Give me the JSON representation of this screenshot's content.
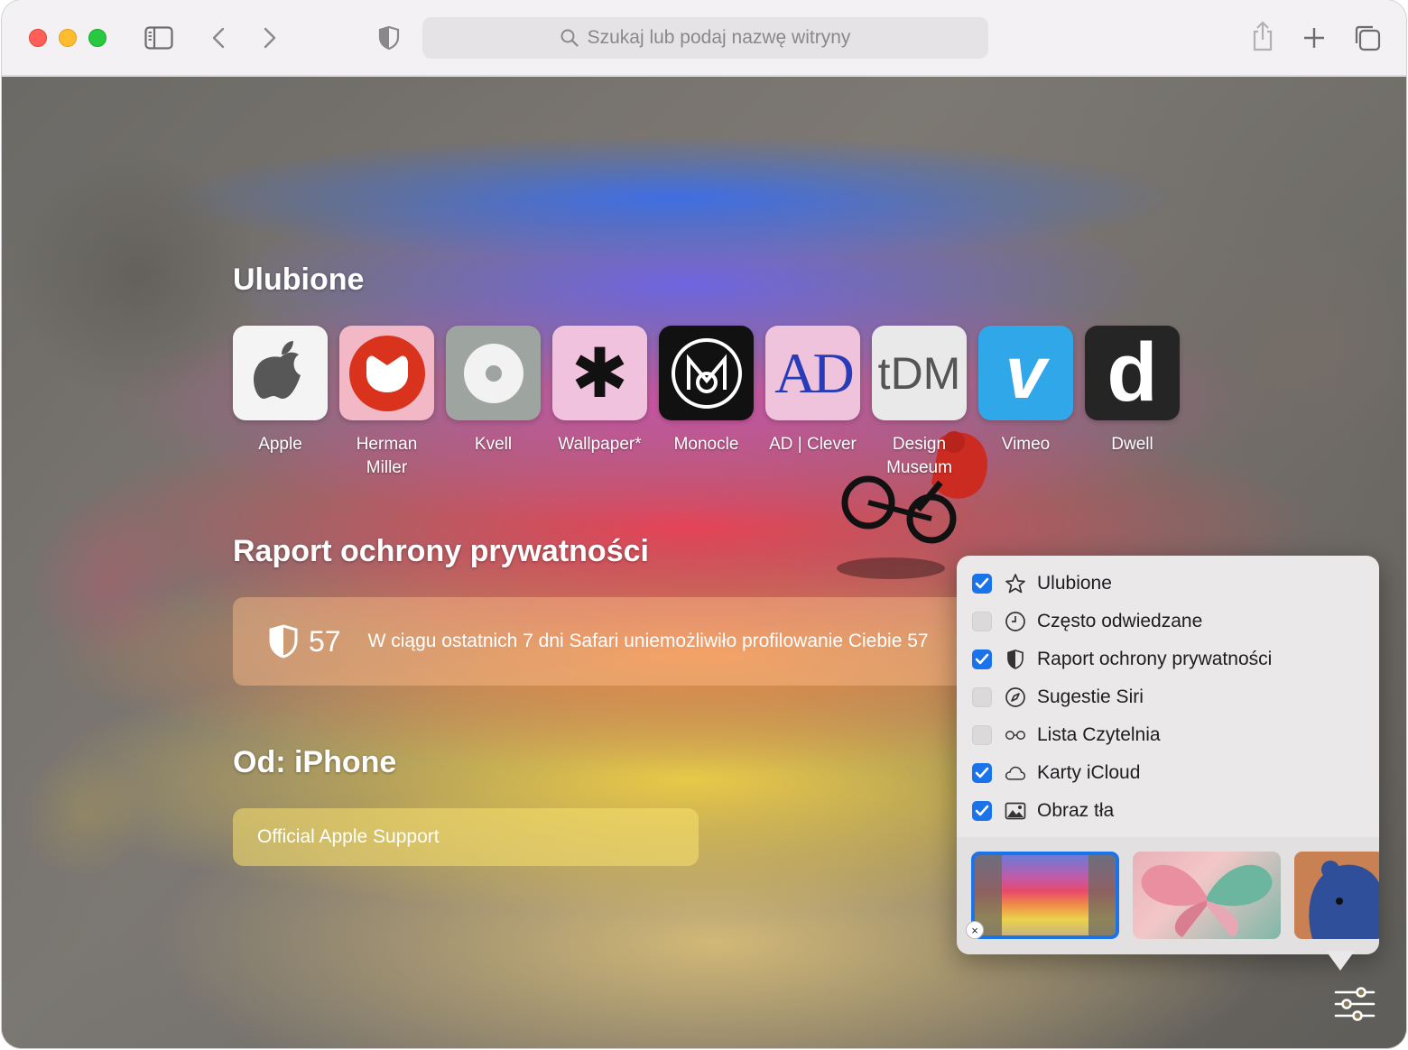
{
  "toolbar": {
    "search_placeholder": "Szukaj lub podaj nazwę witryny"
  },
  "favorites": {
    "title": "Ulubione",
    "items": [
      {
        "label": "Apple",
        "icon": "apple-logo-icon"
      },
      {
        "label": "Herman\nMiller",
        "icon": "herman-miller-logo-icon"
      },
      {
        "label": "Kvell",
        "icon": "kvell-logo-icon"
      },
      {
        "label": "Wallpaper*",
        "icon": "wallpaper-asterisk-icon",
        "glyph": "✱"
      },
      {
        "label": "Monocle",
        "icon": "monocle-logo-icon"
      },
      {
        "label": "AD | Clever",
        "icon": "ad-logo-icon",
        "glyph": "AD"
      },
      {
        "label": "Design\nMuseum",
        "icon": "tdm-logo-icon",
        "glyph": "tDM"
      },
      {
        "label": "Vimeo",
        "icon": "vimeo-logo-icon",
        "glyph": "v"
      },
      {
        "label": "Dwell",
        "icon": "dwell-logo-icon",
        "glyph": "d"
      }
    ]
  },
  "privacy": {
    "title": "Raport ochrony prywatności",
    "count": "57",
    "message": "W ciągu ostatnich 7 dni Safari uniemożliwiło profilowanie Ciebie 57"
  },
  "iphone": {
    "title": "Od: iPhone",
    "tab_label": "Official Apple Support"
  },
  "customize": {
    "options": [
      {
        "label": "Ulubione",
        "checked": true,
        "icon": "star-icon"
      },
      {
        "label": "Często odwiedzane",
        "checked": false,
        "icon": "clock-icon"
      },
      {
        "label": "Raport ochrony prywatności",
        "checked": true,
        "icon": "shield-icon"
      },
      {
        "label": "Sugestie Siri",
        "checked": false,
        "icon": "compass-icon"
      },
      {
        "label": "Lista Czytelnia",
        "checked": false,
        "icon": "glasses-icon"
      },
      {
        "label": "Karty iCloud",
        "checked": true,
        "icon": "cloud-icon"
      },
      {
        "label": "Obraz tła",
        "checked": true,
        "icon": "image-icon"
      }
    ],
    "remove_glyph": "×"
  },
  "colors": {
    "accent": "#1a73e8",
    "toolbar_bg": "#f3f1f3",
    "popover_bg": "#ebe8ea"
  }
}
